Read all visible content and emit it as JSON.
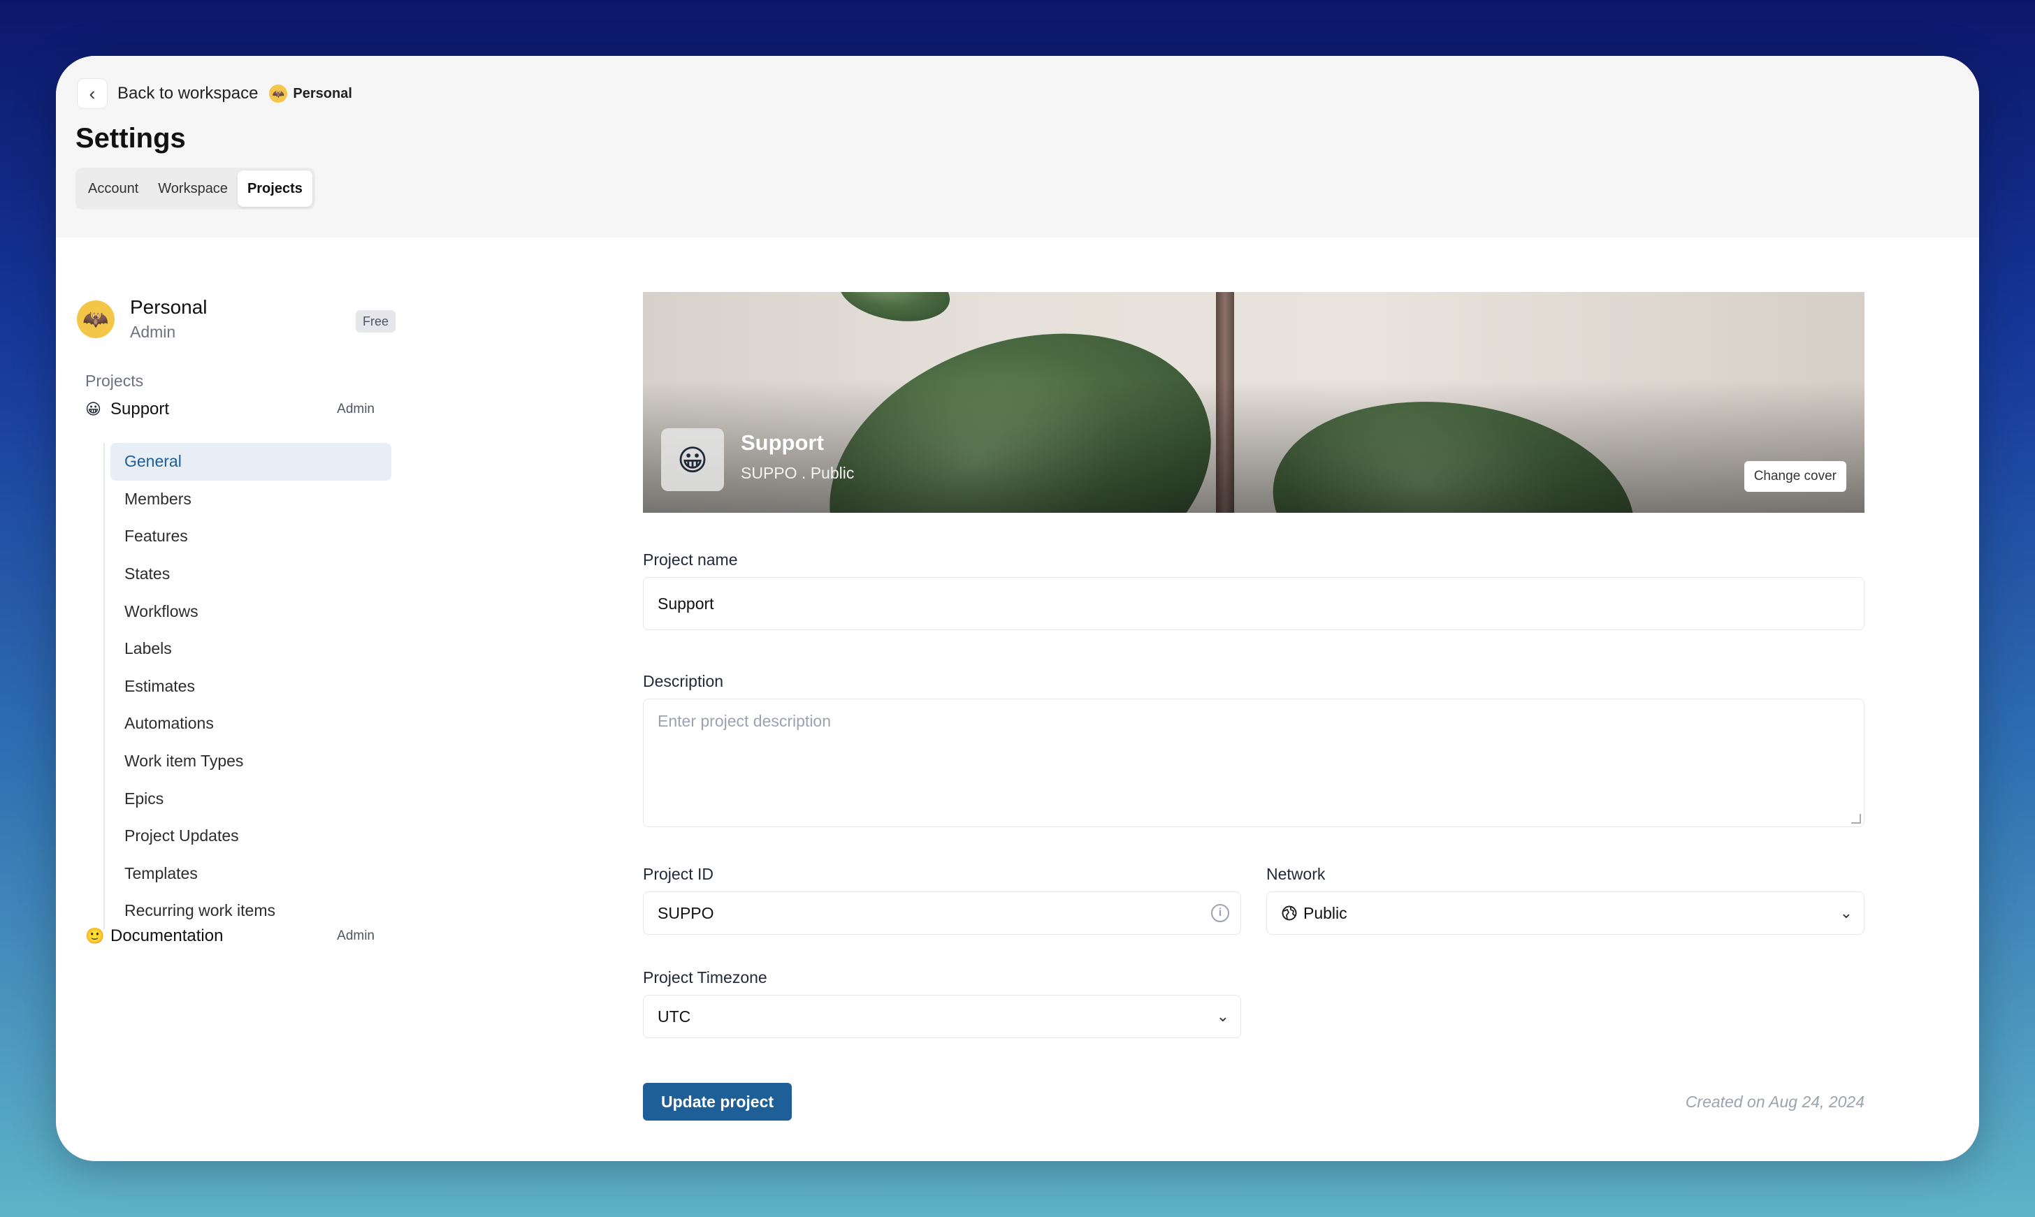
{
  "header": {
    "back_label": "Back to workspace",
    "workspace_name": "Personal",
    "title": "Settings",
    "tabs": [
      {
        "label": "Account"
      },
      {
        "label": "Workspace"
      },
      {
        "label": "Projects"
      }
    ]
  },
  "sidebar": {
    "user": {
      "name": "Personal",
      "role": "Admin",
      "plan": "Free"
    },
    "section_label": "Projects",
    "projects": [
      {
        "name": "Support",
        "role": "Admin",
        "emoji": "😀"
      },
      {
        "name": "Documentation",
        "role": "Admin",
        "emoji": "🙂"
      }
    ],
    "nav": [
      {
        "label": "General"
      },
      {
        "label": "Members"
      },
      {
        "label": "Features"
      },
      {
        "label": "States"
      },
      {
        "label": "Workflows"
      },
      {
        "label": "Labels"
      },
      {
        "label": "Estimates"
      },
      {
        "label": "Automations"
      },
      {
        "label": "Work item Types"
      },
      {
        "label": "Epics"
      },
      {
        "label": "Project Updates"
      },
      {
        "label": "Templates"
      },
      {
        "label": "Recurring work items"
      }
    ]
  },
  "cover": {
    "emoji": "😀",
    "project_name": "Support",
    "subtitle": "SUPPO .  Public",
    "change_cover_label": "Change cover"
  },
  "form": {
    "name_label": "Project name",
    "name_value": "Support",
    "description_label": "Description",
    "description_placeholder": "Enter project description",
    "id_label": "Project ID",
    "id_value": "SUPPO",
    "network_label": "Network",
    "network_value": "Public",
    "timezone_label": "Project Timezone",
    "timezone_value": "UTC",
    "update_label": "Update project",
    "created_text": "Created on Aug 24, 2024"
  },
  "colors": {
    "accent": "#1f5f97",
    "active_nav_bg": "#e8eef5"
  }
}
